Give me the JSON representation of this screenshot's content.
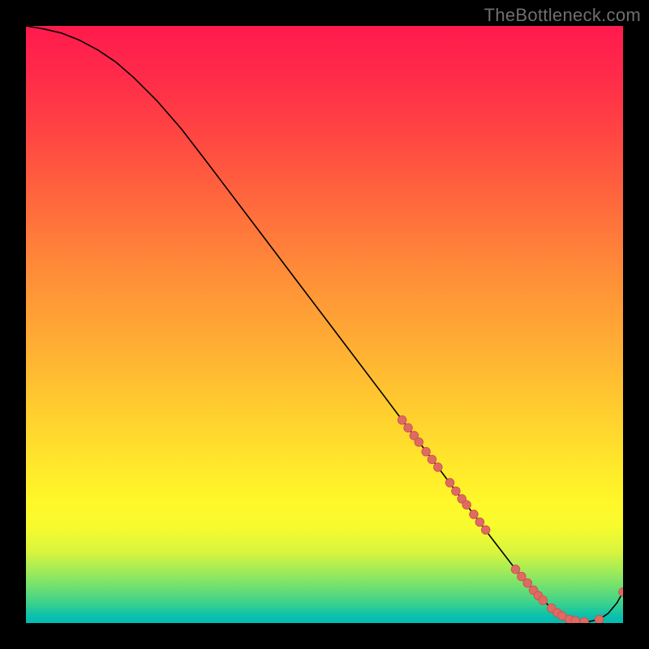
{
  "watermark": "TheBottleneck.com",
  "colors": {
    "curve": "#000000",
    "dot_fill": "#e06a63",
    "dot_stroke": "#c7544e",
    "background_black": "#000000"
  },
  "chart_data": {
    "type": "line",
    "title": "",
    "xlabel": "",
    "ylabel": "",
    "xlim": [
      0,
      100
    ],
    "ylim": [
      0,
      100
    ],
    "grid": false,
    "curve": {
      "x": [
        0,
        3,
        6,
        9,
        12,
        15,
        18,
        22,
        26,
        30,
        35,
        40,
        45,
        50,
        55,
        60,
        63,
        66,
        69,
        72,
        75,
        78,
        80,
        82,
        84,
        86,
        88,
        90,
        92,
        94,
        96,
        97.5,
        99,
        100
      ],
      "y": [
        100,
        99.5,
        98.8,
        97.6,
        96.0,
        94.0,
        91.4,
        87.4,
        82.8,
        77.6,
        71.0,
        64.4,
        57.8,
        51.2,
        44.6,
        38.0,
        34.0,
        30.1,
        26.1,
        22.1,
        18.2,
        14.2,
        11.6,
        9.0,
        6.7,
        4.4,
        2.5,
        1.1,
        0.4,
        0.2,
        0.6,
        1.6,
        3.4,
        5.2
      ]
    },
    "dots": [
      {
        "x": 63.0,
        "y": 34.0
      },
      {
        "x": 64.0,
        "y": 32.7
      },
      {
        "x": 65.0,
        "y": 31.4
      },
      {
        "x": 65.8,
        "y": 30.3
      },
      {
        "x": 67.0,
        "y": 28.7
      },
      {
        "x": 68.0,
        "y": 27.4
      },
      {
        "x": 69.0,
        "y": 26.1
      },
      {
        "x": 71.0,
        "y": 23.5
      },
      {
        "x": 72.0,
        "y": 22.1
      },
      {
        "x": 73.0,
        "y": 20.8
      },
      {
        "x": 73.8,
        "y": 19.8
      },
      {
        "x": 75.0,
        "y": 18.2
      },
      {
        "x": 76.0,
        "y": 16.9
      },
      {
        "x": 77.0,
        "y": 15.6
      },
      {
        "x": 82.0,
        "y": 9.0
      },
      {
        "x": 83.0,
        "y": 7.8
      },
      {
        "x": 84.0,
        "y": 6.7
      },
      {
        "x": 85.0,
        "y": 5.5
      },
      {
        "x": 85.8,
        "y": 4.6
      },
      {
        "x": 86.6,
        "y": 3.8
      },
      {
        "x": 88.0,
        "y": 2.5
      },
      {
        "x": 89.0,
        "y": 1.7
      },
      {
        "x": 89.8,
        "y": 1.2
      },
      {
        "x": 91.0,
        "y": 0.6
      },
      {
        "x": 92.0,
        "y": 0.4
      },
      {
        "x": 93.5,
        "y": 0.2
      },
      {
        "x": 96.0,
        "y": 0.6
      },
      {
        "x": 100.0,
        "y": 5.2
      }
    ]
  }
}
